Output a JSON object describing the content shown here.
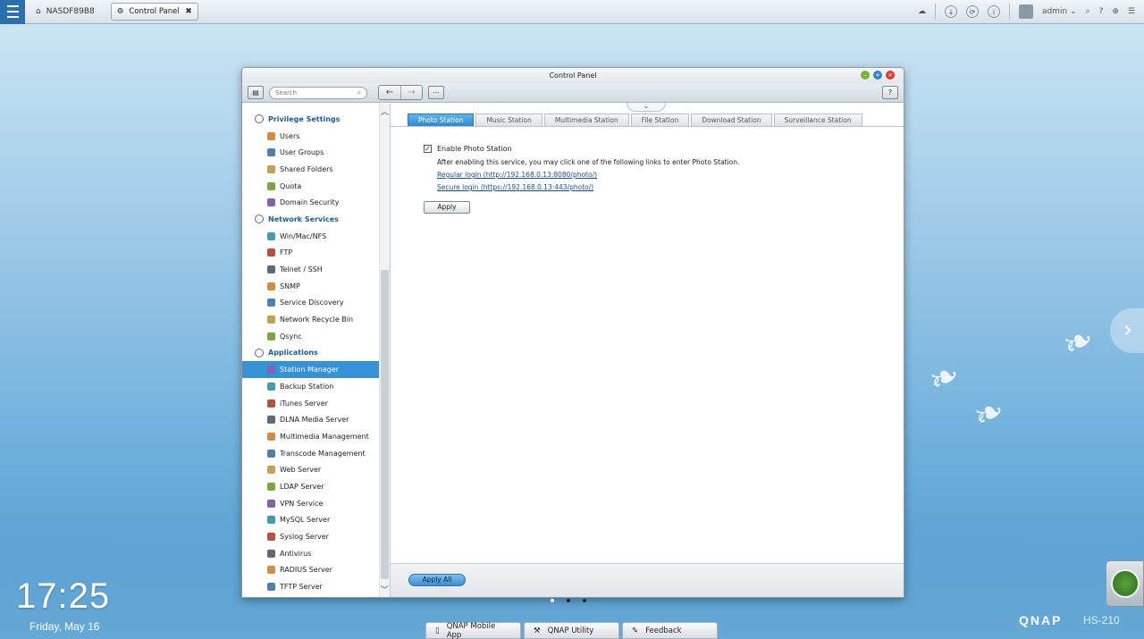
{
  "taskbar": {
    "device_name": "NASDF89B8",
    "open_app": "Control Panel",
    "user": "admin"
  },
  "window": {
    "title": "Control Panel",
    "search_placeholder": "Search"
  },
  "sidebar": {
    "groups": [
      {
        "label": "Privilege Settings",
        "items": [
          "Users",
          "User Groups",
          "Shared Folders",
          "Quota",
          "Domain Security"
        ]
      },
      {
        "label": "Network Services",
        "items": [
          "Win/Mac/NFS",
          "FTP",
          "Telnet / SSH",
          "SNMP",
          "Service Discovery",
          "Network Recycle Bin",
          "Qsync"
        ]
      },
      {
        "label": "Applications",
        "items": [
          "Station Manager",
          "Backup Station",
          "iTunes Server",
          "DLNA Media Server",
          "Multimedia Management",
          "Transcode Management",
          "Web Server",
          "LDAP Server",
          "VPN Service",
          "MySQL Server",
          "Syslog Server",
          "Antivirus",
          "RADIUS Server",
          "TFTP Server"
        ]
      }
    ],
    "active_item": "Station Manager"
  },
  "tabs": [
    "Photo Station",
    "Music Station",
    "Multimedia Station",
    "File Station",
    "Download Station",
    "Surveillance Station"
  ],
  "active_tab": "Photo Station",
  "panel": {
    "enable_label": "Enable Photo Station",
    "enabled": true,
    "description": "After enabling this service, you may click one of the following links to enter Photo Station.",
    "regular_login": "Regular login (http://192.168.0.13:8080/photo/)",
    "secure_login": "Secure login (https://192.168.0.13:443/photo/)",
    "apply_label": "Apply",
    "apply_all_label": "Apply All"
  },
  "desktop": {
    "time": "17:25",
    "date": "Friday, May 16",
    "brand": "QNAP",
    "model": "HS-210",
    "dock": [
      "QNAP Mobile App",
      "QNAP Utility",
      "Feedback"
    ]
  }
}
